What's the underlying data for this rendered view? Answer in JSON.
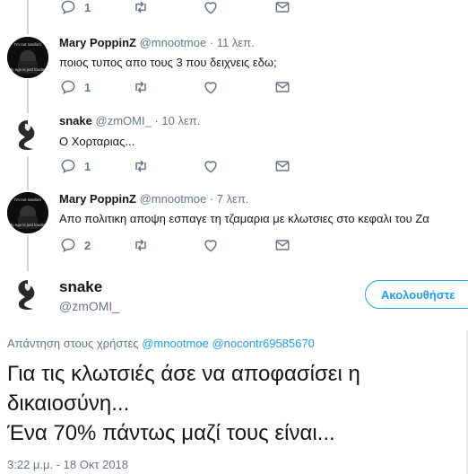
{
  "top_actions": {
    "reply_count": "1"
  },
  "tweets": [
    {
      "name": "Mary PoppinZ",
      "handle": "@mnootmoe",
      "time": "· 11 λεπ.",
      "text": "ποιος τυπος απο τους 3 που δειχνεις εδω;",
      "reply_count": "1",
      "avatar_caption_top": "I'm not random",
      "avatar_caption_bottom": "My ego is just louder"
    },
    {
      "name": "snake",
      "handle": "@zmOMI_",
      "time": "· 10 λεπ.",
      "text": "Ο Χορταριας...",
      "reply_count": "1"
    },
    {
      "name": "Mary PoppinZ",
      "handle": "@mnootmoe",
      "time": "· 7 λεπ.",
      "text": "Απο πολιτικη αποψη εσπαγε τη τζαμαρια με κλωτσιες στο κεφαλι του Ζα",
      "reply_count": "2",
      "avatar_caption_top": "I'm not random",
      "avatar_caption_bottom": "My ego is just louder"
    }
  ],
  "main_tweet": {
    "name": "snake",
    "handle": "@zmOMI_",
    "follow_label": "Ακολουθήστε",
    "replying_prefix": "Απάντηση στους χρήστες",
    "mention_1": "@mnootmoe",
    "mention_2": "@nocontr69585670",
    "line_1": "Για τις κλωτσιές άσε να αποφασίσει η",
    "line_2": "δικαιοσύνη...",
    "line_3": "Ένα 70%  πάντως μαζί τους είναι...",
    "timestamp": "3:22 μ.μ. - 18 Οκτ 2018"
  },
  "colors": {
    "accent": "#1da1f2",
    "muted": "#657786",
    "text": "#14171a",
    "line": "#ccd6dd"
  }
}
